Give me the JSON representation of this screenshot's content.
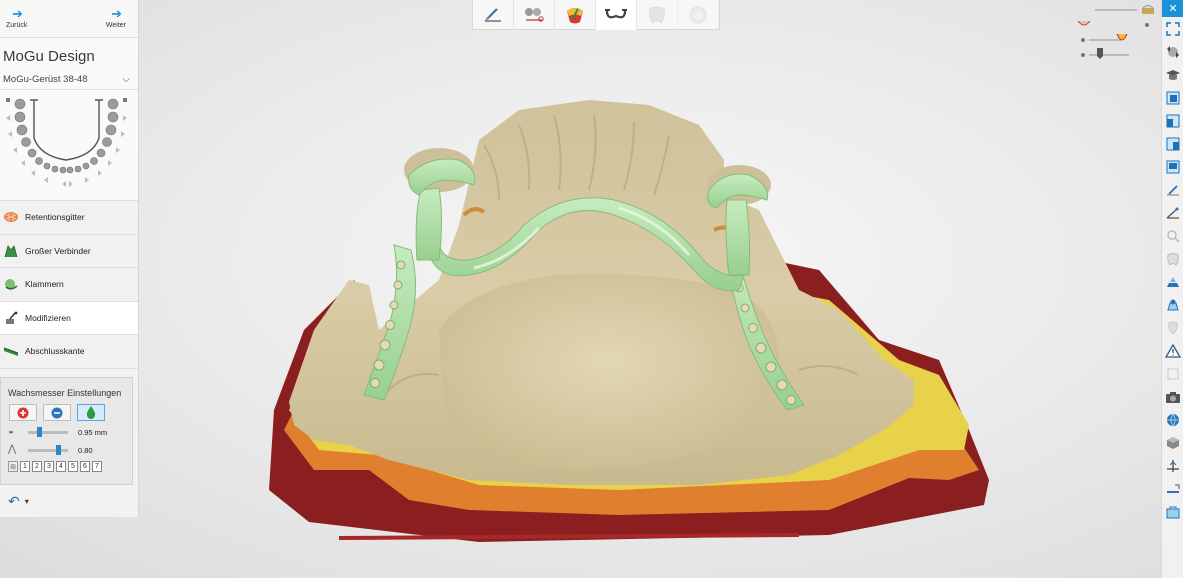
{
  "nav": {
    "back_label": "Zurück",
    "forward_label": "Weiter"
  },
  "app": {
    "title": "MoGu Design"
  },
  "case": {
    "selected": "MoGu-Gerüst 38-48"
  },
  "steps": [
    {
      "label": "Retentionsgitter",
      "icon": "retention-grid-icon",
      "active": false
    },
    {
      "label": "Großer Verbinder",
      "icon": "major-connector-icon",
      "active": false
    },
    {
      "label": "Klammern",
      "icon": "clasp-icon",
      "active": false
    },
    {
      "label": "Modifizieren",
      "icon": "modify-icon",
      "active": true
    },
    {
      "label": "Abschlusskante",
      "icon": "finish-line-icon",
      "active": false
    }
  ],
  "wax_knife": {
    "title": "Wachsmesser Einstellungen",
    "tools": [
      "add-wax-icon",
      "remove-wax-icon",
      "smooth-wax-icon"
    ],
    "selected_tool": "smooth-wax-icon",
    "size_value": "0.95 mm",
    "size_fraction": 0.25,
    "strength_value": "0.80",
    "strength_fraction": 0.8,
    "levels": [
      "1",
      "2",
      "3",
      "4",
      "5",
      "6",
      "7"
    ]
  },
  "top_toolbar": {
    "steps": [
      "scan-prepare-icon",
      "model-analysis-icon",
      "undercut-icon",
      "framework-design-icon",
      "tooth-icon",
      "finish-icon"
    ],
    "active_index": 3
  },
  "colors": {
    "accent": "#1b92d8",
    "model": "#d8cba3",
    "framework": "#a9d9a2",
    "undercut_red": "#8b1f1f",
    "undercut_orange": "#e0802e",
    "undercut_yellow": "#e8d24a"
  }
}
